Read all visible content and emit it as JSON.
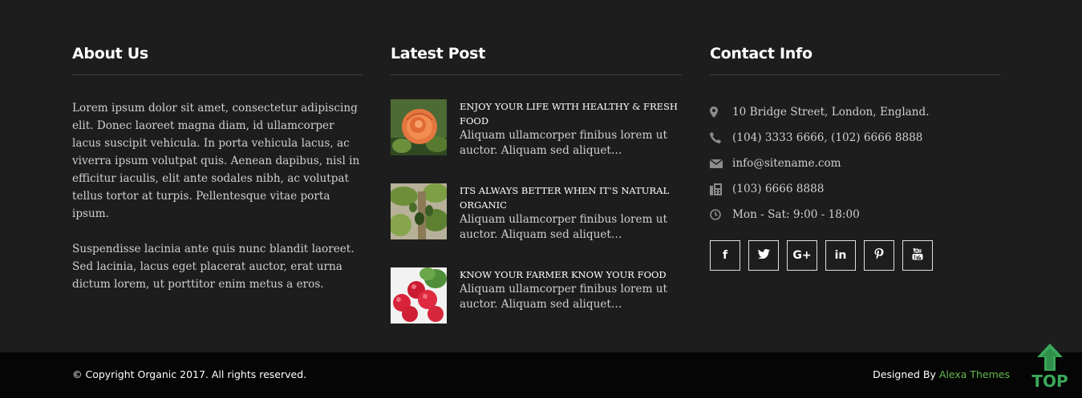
{
  "about": {
    "title": "About Us",
    "paragraphs": [
      "Lorem ipsum dolor sit amet, consectetur adipiscing elit. Donec laoreet magna diam, id ullamcorper lacus suscipit vehicula. In porta vehicula lacus, ac viverra ipsum volutpat quis. Aenean dapibus, nisl in efficitur iaculis, elit ante sodales nibh, ac volutpat tellus tortor at turpis. Pellentesque vitae porta ipsum.",
      "Suspendisse lacinia ante quis nunc blandit laoreet. Sed lacinia, lacus eget placerat auctor, erat urna dictum lorem, ut porttitor enim metus a eros."
    ]
  },
  "latest": {
    "title": "Latest Post",
    "posts": [
      {
        "title": "Enjoy your life with healthy & fresh food",
        "excerpt": "Aliquam ullamcorper finibus lorem ut auctor. Aliquam sed aliquet…"
      },
      {
        "title": "Its always better when it’s natural organic",
        "excerpt": "Aliquam ullamcorper finibus lorem ut auctor. Aliquam sed aliquet…"
      },
      {
        "title": "Know your farmer know your food",
        "excerpt": "Aliquam ullamcorper finibus lorem ut auctor. Aliquam sed aliquet…"
      }
    ]
  },
  "contact": {
    "title": "Contact Info",
    "items": [
      {
        "icon": "map-marker-icon",
        "text": "10 Bridge Street, London, England."
      },
      {
        "icon": "phone-icon",
        "text": "(104) 3333 6666, (102) 6666 8888"
      },
      {
        "icon": "envelope-icon",
        "text": "info@sitename.com"
      },
      {
        "icon": "fax-icon",
        "text": "(103) 6666 8888"
      },
      {
        "icon": "clock-icon",
        "text": "Mon - Sat: 9:00 - 18:00"
      }
    ],
    "social": [
      {
        "icon": "facebook-icon",
        "glyph": "f"
      },
      {
        "icon": "twitter-icon",
        "glyph": ""
      },
      {
        "icon": "google-plus-icon",
        "glyph": "G+"
      },
      {
        "icon": "linkedin-icon",
        "glyph": "in"
      },
      {
        "icon": "pinterest-icon",
        "glyph": ""
      },
      {
        "icon": "youtube-icon",
        "glyph": ""
      }
    ]
  },
  "bottom": {
    "copyright": "© Copyright Organic 2017. All rights reserved.",
    "designed_by": "Designed By",
    "designer": "Alexa Themes"
  },
  "to_top": {
    "label": "TOP"
  },
  "colors": {
    "background": "#1d1d1d",
    "bottom_bar": "#050505",
    "accent": "#64b94e",
    "to_top": "#3aa75a"
  }
}
